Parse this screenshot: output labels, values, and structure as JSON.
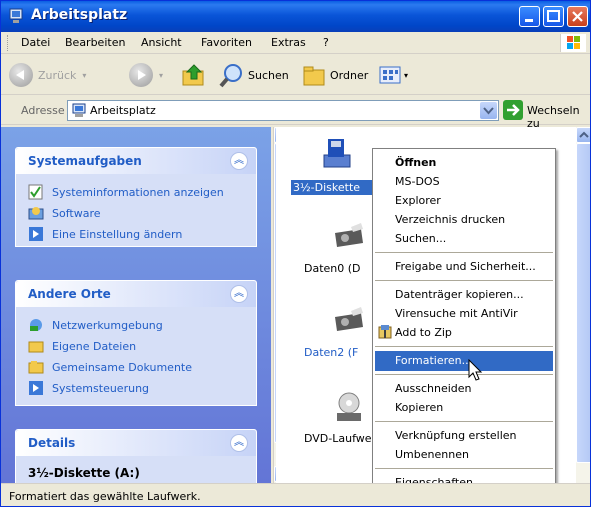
{
  "window": {
    "title": "Arbeitsplatz"
  },
  "menu": {
    "items": [
      "Datei",
      "Bearbeiten",
      "Ansicht",
      "Favoriten",
      "Extras",
      "?"
    ]
  },
  "toolbar": {
    "back": "Zurück",
    "search": "Suchen",
    "folders": "Ordner"
  },
  "address": {
    "label": "Adresse",
    "value": "Arbeitsplatz",
    "go": "Wechseln zu"
  },
  "left": {
    "system": {
      "title": "Systemaufgaben",
      "items": [
        "Systeminformationen anzeigen",
        "Software",
        "Eine Einstellung ändern"
      ]
    },
    "places": {
      "title": "Andere Orte",
      "items": [
        "Netzwerkumgebung",
        "Eigene Dateien",
        "Gemeinsame Dokumente",
        "Systemsteuerung"
      ]
    },
    "details": {
      "title": "Details",
      "item": "3½-Diskette (A:)"
    }
  },
  "drives": [
    "3½-Diskette",
    "Daten0 (D",
    "Daten2 (F",
    "DVD-Laufwer"
  ],
  "context_menu": [
    "Öffnen",
    "MS-DOS",
    "Explorer",
    "Verzeichnis drucken",
    "Suchen...",
    "Freigabe und Sicherheit...",
    "Datenträger kopieren...",
    "Virensuche mit AntiVir",
    "Add to Zip",
    "Formatieren...",
    "Ausschneiden",
    "Kopieren",
    "Verknüpfung erstellen",
    "Umbenennen",
    "Eigenschaften"
  ],
  "statusbar": {
    "text": "Formatiert das gewählte Laufwerk."
  },
  "colors": {
    "title_bar": "#0054e3",
    "highlight": "#316ac5",
    "task_link": "#215dc6"
  }
}
